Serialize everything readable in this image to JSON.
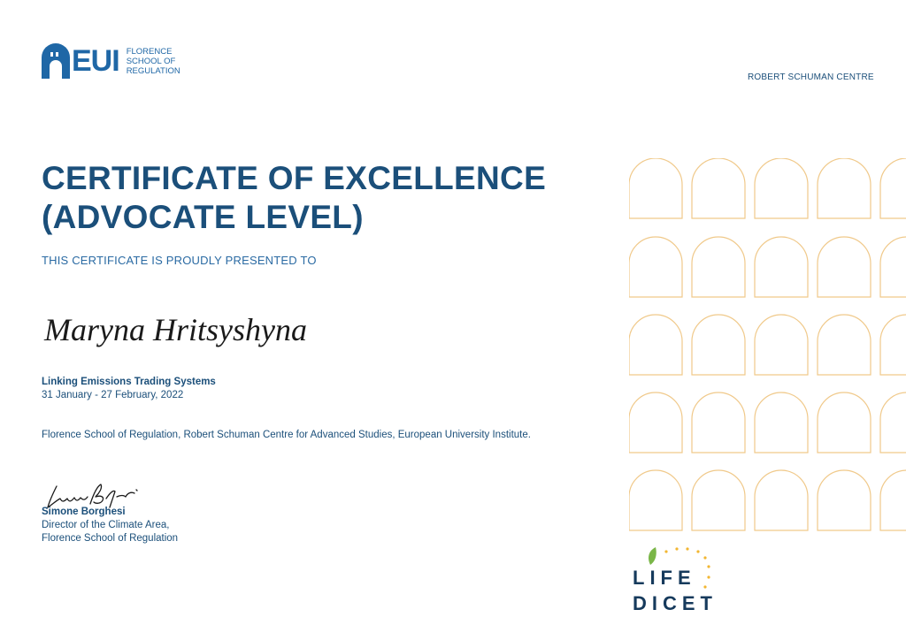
{
  "header": {
    "logo_text": "EUI",
    "logo_sub": [
      "FLORENCE",
      "SCHOOL OF",
      "REGULATION"
    ],
    "right_label": "ROBERT SCHUMAN CENTRE"
  },
  "certificate": {
    "title": "CERTIFICATE OF EXCELLENCE (ADVOCATE LEVEL)",
    "presented_to": "THIS CERTIFICATE IS PROUDLY PRESENTED TO",
    "recipient": "Maryna Hritsyshyna",
    "course_title": "Linking Emissions Trading Systems",
    "course_dates": "31 January - 27 February, 2022",
    "institutions": "Florence School of Regulation, Robert Schuman Centre for Advanced Studies, European University Institute."
  },
  "signatory": {
    "name": "Simone Borghesi",
    "role_line1": "Director of the Climate Area,",
    "role_line2": "Florence School of Regulation"
  },
  "footer_logo": {
    "line1": "LIFE",
    "line2": "DICET"
  },
  "colors": {
    "primary_blue": "#1b4f7a",
    "logo_blue": "#1f67a6",
    "arch_orange": "#f0c98a",
    "leaf_green": "#7ab648",
    "star_gold": "#f2b632",
    "logo_dark": "#163a5c"
  }
}
